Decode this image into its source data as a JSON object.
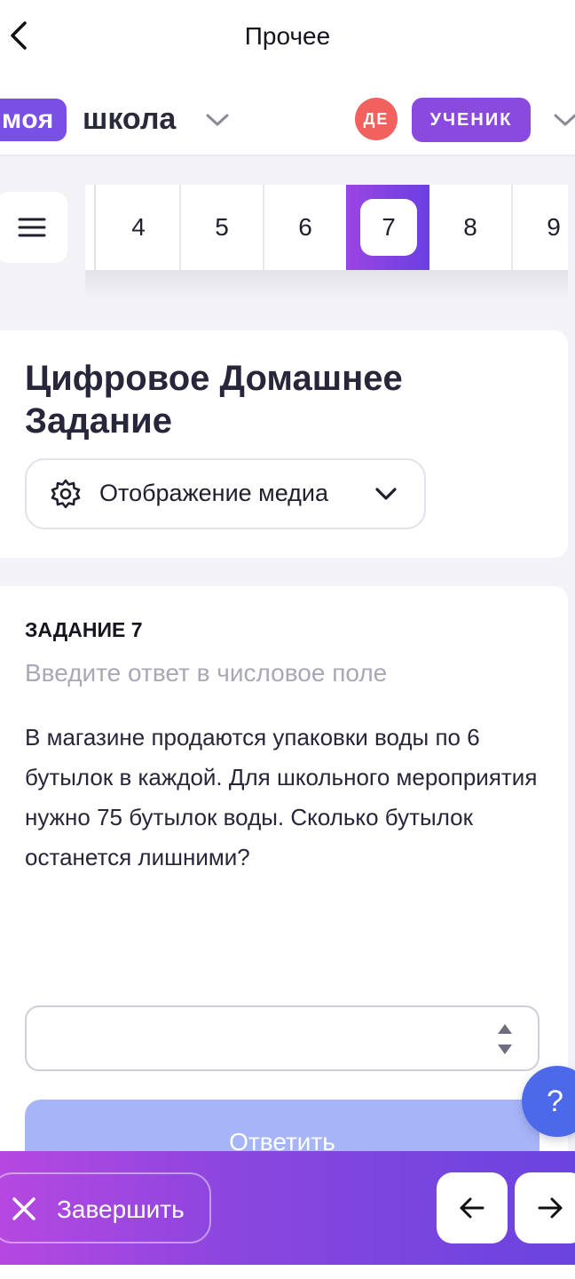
{
  "header": {
    "title": "Прочее"
  },
  "brand": {
    "logo_part1": "моя",
    "logo_part2": "школа",
    "avatar_initials": "ДЕ",
    "role": "УЧЕНИК"
  },
  "pager": {
    "pages": [
      "4",
      "5",
      "6",
      "7",
      "8",
      "9"
    ],
    "active": "7"
  },
  "card": {
    "title": "Цифровое Домашнее Задание",
    "media_button": "Отображение медиа"
  },
  "task": {
    "number_label": "ЗАДАНИЕ 7",
    "hint": "Введите ответ в числовое поле",
    "text": "В магазине продаются упаковки воды по 6 бутылок в каждой. Для школьного мероприятия нужно 75 бутылок воды. Сколько бутылок останется лишними?",
    "answer_value": "",
    "submit_label": "Ответить"
  },
  "help": {
    "label": "?"
  },
  "footer": {
    "finish_label": "Завершить"
  },
  "colors": {
    "accent": "#7a4fe6",
    "avatar": "#f2615d",
    "submit_disabled": "#a5b5f7",
    "help": "#4b69e9"
  },
  "icons": [
    "back-arrow-icon",
    "chevron-down-icon",
    "menu-icon",
    "gear-icon",
    "close-icon",
    "arrow-left-icon",
    "arrow-right-icon"
  ]
}
